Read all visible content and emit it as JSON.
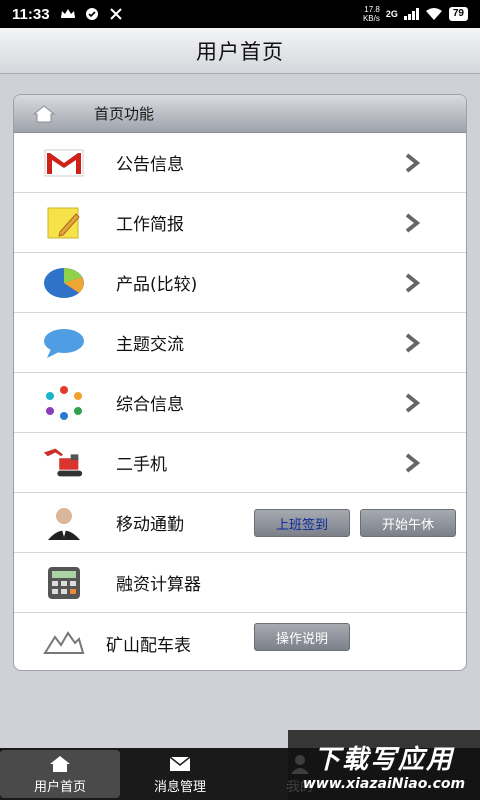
{
  "status_bar": {
    "time": "11:33",
    "speed_top": "17.8",
    "speed_bottom": "KB/s",
    "network": "2G",
    "battery": "79"
  },
  "title": "用户首页",
  "card": {
    "header": "首页功能",
    "items": [
      {
        "label": "公告信息",
        "icon": "mail-icon"
      },
      {
        "label": "工作简报",
        "icon": "notepad-icon"
      },
      {
        "label": "产品(比较)",
        "icon": "pie-chart-icon"
      },
      {
        "label": "主题交流",
        "icon": "speech-bubble-icon"
      },
      {
        "label": "综合信息",
        "icon": "people-circle-icon"
      },
      {
        "label": "二手机",
        "icon": "excavator-icon"
      },
      {
        "label": "移动通勤",
        "icon": "person-avatar-icon",
        "buttons": [
          "上班签到",
          "开始午休"
        ]
      },
      {
        "label": "融资计算器",
        "icon": "calculator-icon"
      },
      {
        "label": "矿山配车表",
        "icon": "mountain-icon",
        "buttons": [
          "操作说明"
        ]
      }
    ]
  },
  "tabs": [
    {
      "label": "用户首页",
      "icon": "home-icon",
      "active": true
    },
    {
      "label": "消息管理",
      "icon": "envelope-icon"
    },
    {
      "label": "我的",
      "icon": "user-icon"
    }
  ],
  "watermark": {
    "title": "下载写应用",
    "url": "www.xiazaiNiao.com"
  }
}
